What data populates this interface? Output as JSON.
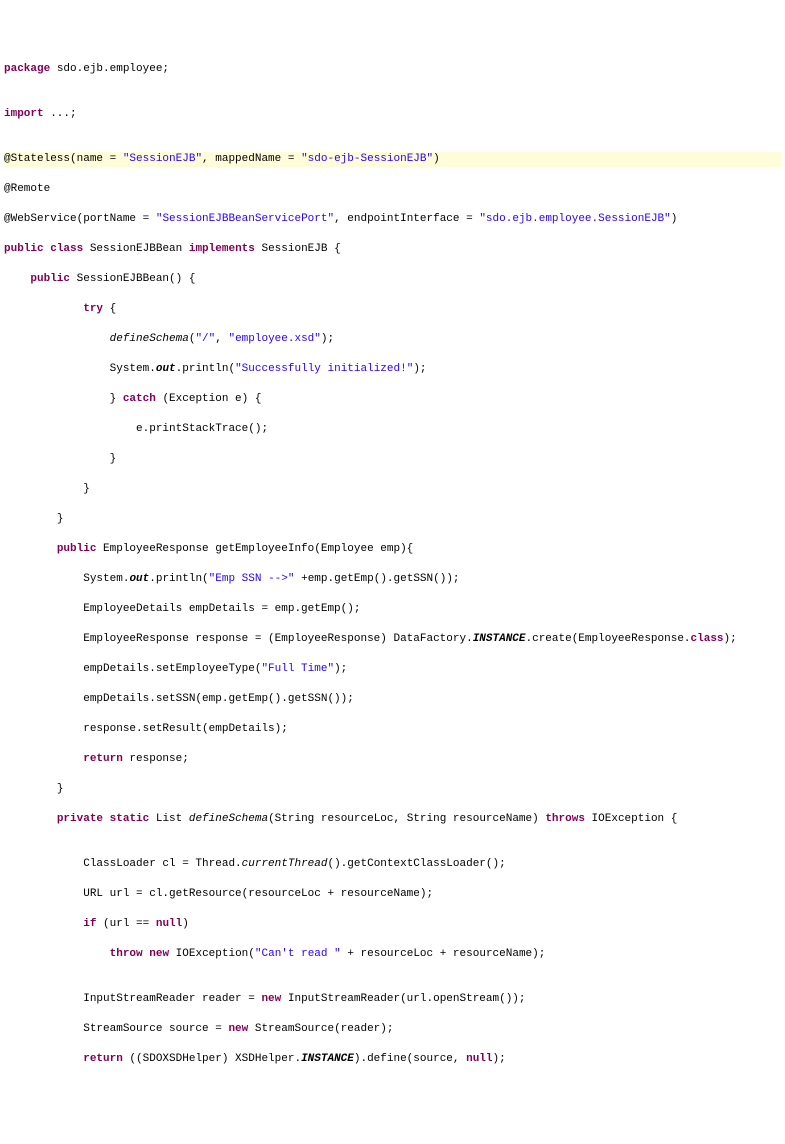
{
  "code": {
    "package_kw": "package",
    "package_name": " sdo.ejb.employee;",
    "import_kw": "import",
    "import_rest": " ...;",
    "stateless_at": "@Stateless",
    "stateless_args": "(name = ",
    "stateless_str1": "\"SessionEJB\"",
    "stateless_mid": ", mappedName = ",
    "stateless_str2": "\"sdo-ejb-SessionEJB\"",
    "stateless_close": ")",
    "remote": "@Remote",
    "webservice_at": "@WebService",
    "webservice_args": "(portName = ",
    "webservice_str1": "\"SessionEJBBeanServicePort\"",
    "webservice_mid": ", endpointInterface = ",
    "webservice_str2": "\"sdo.ejb.employee.SessionEJB\"",
    "webservice_close": ")",
    "public_kw": "public",
    "class_kw": "class",
    "classname": " SessionEJBBean ",
    "implements_kw": "implements",
    "impl_name": " SessionEJB {",
    "ctor_name": " SessionEJBBean() {",
    "try_kw": "try",
    "try_brace": " {",
    "defineSchema_call": "defineSchema",
    "defineSchema_args1": "(",
    "defineSchema_str1": "\"/\"",
    "defineSchema_comma": ", ",
    "defineSchema_str2": "\"employee.xsd\"",
    "defineSchema_close": ");",
    "system": "System.",
    "out": "out",
    "println": ".println(",
    "println_str": "\"Successfully initialized!\"",
    "println_close": ");",
    "catch_brace": "} ",
    "catch_kw": "catch",
    "catch_args": " (Exception e) {",
    "printstack": "e.printStackTrace();",
    "close_brace": "}",
    "empresp_ret": " EmployeeResponse getEmployeeInfo(Employee emp){",
    "emp_ssn_str": "\"Emp SSN -->\"",
    "emp_ssn_rest": " +emp.getEmp().getSSN());",
    "empdetails_line": "EmployeeDetails empDetails = emp.getEmp();",
    "response_line1": "EmployeeResponse response = (EmployeeResponse) DataFactory.",
    "instance": "INSTANCE",
    "response_line2": ".create(EmployeeResponse.",
    "class_ref": "class",
    "response_close": ");",
    "settype_pre": "empDetails.setEmployeeType(",
    "settype_str": "\"Full Time\"",
    "settype_close": ");",
    "setssn": "empDetails.setSSN(emp.getEmp().getSSN());",
    "setresult": "response.setResult(empDetails);",
    "return_kw": "return",
    "return_resp": " response;",
    "private_kw": "private",
    "static_kw": "static",
    "list_ret": " List ",
    "defineSchema_italic": "defineSchema",
    "defineSchema_sig": "(String resourceLoc, String resourceName) ",
    "throws_kw": "throws",
    "throws_rest": " IOException {",
    "classloader": "ClassLoader cl = Thread.",
    "currentThread": "currentThread",
    "classloader_rest": "().getContextClassLoader();",
    "url_line": "URL url = cl.getResource(resourceLoc + resourceName);",
    "if_kw": "if",
    "if_cond": " (url == ",
    "null_kw": "null",
    "if_close": ")",
    "throw_kw": "throw",
    "new_kw": "new",
    "ioexception": " IOException(",
    "cantread_str": "\"Can't read \"",
    "throw_rest": " + resourceLoc + resourceName);",
    "reader_pre": "InputStreamReader reader = ",
    "reader_post": " InputStreamReader(url.openStream());",
    "source_pre": "StreamSource source = ",
    "source_post": " StreamSource(reader);",
    "return_cast": " ((SDOXSDHelper) XSDHelper.",
    "define_call": ").define(source, ",
    "define_close": ");"
  }
}
